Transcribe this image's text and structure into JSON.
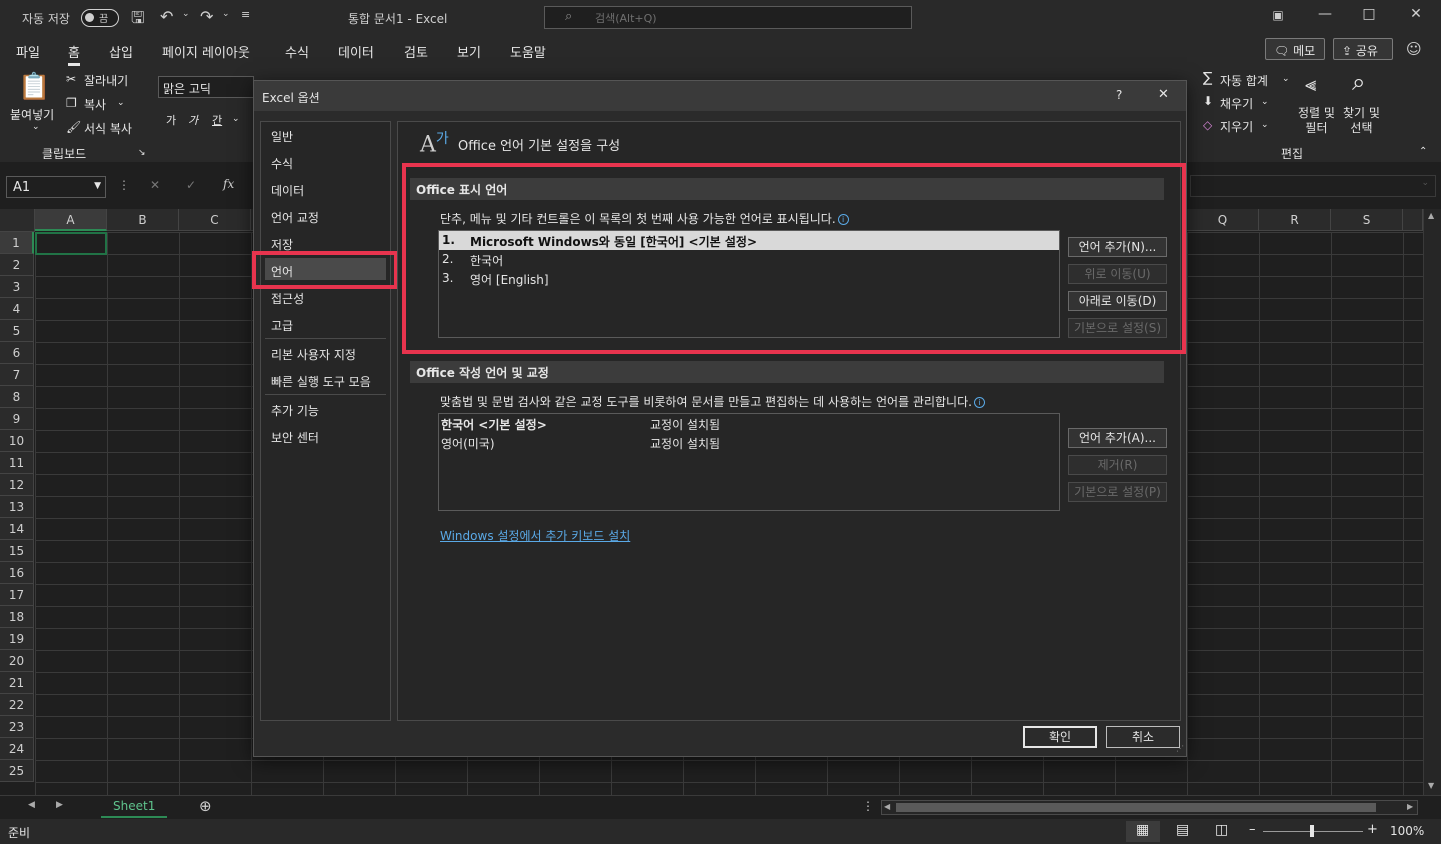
{
  "titlebar": {
    "autosave_label": "자동 저장",
    "autosave_state": "끔",
    "doc_title": "통합 문서1  -  Excel",
    "search_placeholder": "검색(Alt+Q)"
  },
  "menu": {
    "items": [
      "파일",
      "홈",
      "삽입",
      "페이지 레이아웃",
      "수식",
      "데이터",
      "검토",
      "보기",
      "도움말"
    ],
    "active": "홈",
    "memo_label": "메모",
    "share_label": "공유"
  },
  "ribbon": {
    "paste_label": "붙여넣기",
    "cut_label": "잘라내기",
    "copy_label": "복사",
    "format_painter_label": "서식 복사",
    "clipboard_group": "클립보드",
    "font_name": "맑은 고딕",
    "font_sizes": [
      "가",
      "가",
      "간"
    ],
    "autosum_label": "자동 합계",
    "fill_label": "채우기",
    "clear_label": "지우기",
    "sort_filter_label": "정렬 및\n필터",
    "find_select_label": "찾기 및\n선택",
    "editing_group": "편집"
  },
  "formula": {
    "namebox": "A1",
    "fx": "fx"
  },
  "grid": {
    "columns_left": [
      "A",
      "B",
      "C"
    ],
    "columns_right": [
      "Q",
      "R",
      "S"
    ],
    "rows": [
      "1",
      "2",
      "3",
      "4",
      "5",
      "6",
      "7",
      "8",
      "9",
      "10",
      "11",
      "12",
      "13",
      "14",
      "15",
      "16",
      "17",
      "18",
      "19",
      "20",
      "21",
      "22",
      "23",
      "24",
      "25"
    ]
  },
  "sheets": {
    "tabs": [
      "Sheet1"
    ]
  },
  "status": {
    "ready": "준비",
    "zoom": "100%"
  },
  "dialog": {
    "title": "Excel 옵션",
    "help": "?",
    "close": "✕",
    "nav": [
      "일반",
      "수식",
      "데이터",
      "언어 교정",
      "저장",
      "언어",
      "접근성",
      "고급",
      "리본 사용자 지정",
      "빠른 실행 도구 모음",
      "추가 기능",
      "보안 센터"
    ],
    "selected_nav": "언어",
    "heading": "Office 언어 기본 설정을 구성",
    "display": {
      "header": "Office 표시 언어",
      "description": "단추, 메뉴 및 기타 컨트롤은 이 목록의 첫 번째 사용 가능한 언어로 표시됩니다.",
      "items": [
        {
          "num": "1.",
          "name": "Microsoft Windows와 동일 [한국어] <기본 설정>"
        },
        {
          "num": "2.",
          "name": "한국어"
        },
        {
          "num": "3.",
          "name": "영어 [English]"
        }
      ],
      "buttons": {
        "add": "언어 추가(N)...",
        "move_up": "위로 이동(U)",
        "move_down": "아래로 이동(D)",
        "set_default": "기본으로 설정(S)"
      }
    },
    "authoring": {
      "header": "Office 작성 언어 및 교정",
      "description": "맞춤법 및 문법 검사와 같은 교정 도구를 비롯하여 문서를 만들고 편집하는 데 사용하는 언어를 관리합니다.",
      "items": [
        {
          "name": "한국어 <기본 설정>",
          "status": "교정이 설치됨"
        },
        {
          "name": "영어(미국)",
          "status": "교정이 설치됨"
        }
      ],
      "buttons": {
        "add": "언어 추가(A)...",
        "remove": "제거(R)",
        "set_default": "기본으로 설정(P)"
      }
    },
    "keyboard_link": "Windows 설정에서 추가 키보드 설치",
    "ok": "확인",
    "cancel": "취소"
  },
  "colors": {
    "highlight": "#e8344e",
    "link": "#5aa9e6",
    "selected_cell_border": "#217346"
  }
}
